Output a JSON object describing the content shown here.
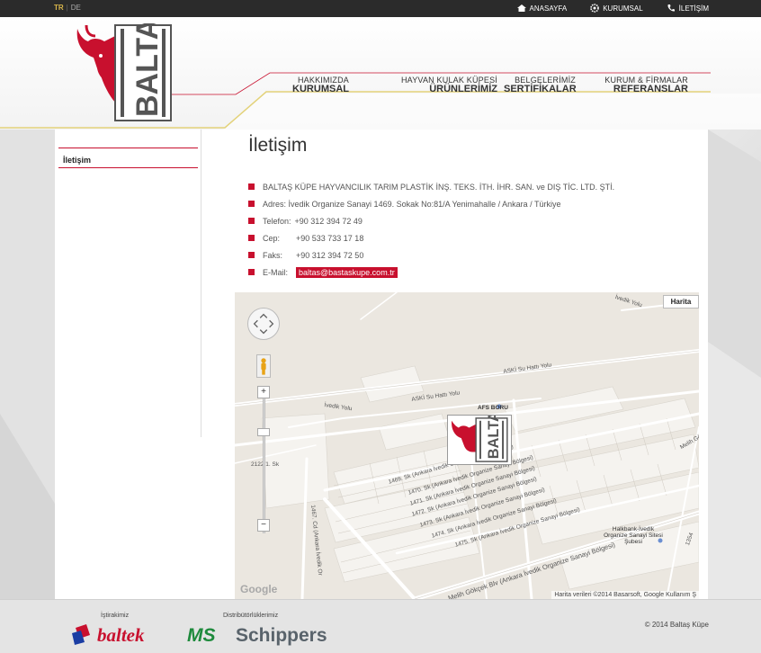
{
  "topbar": {
    "lang_tr": "TR",
    "lang_de": "DE",
    "nav": [
      {
        "label": "ANASAYFA",
        "icon": "home-icon"
      },
      {
        "label": "KURUMSAL",
        "icon": "gear-icon"
      },
      {
        "label": "İLETİŞİM",
        "icon": "phone-icon"
      }
    ]
  },
  "brand": {
    "name": "BALTAŞ",
    "accent": "#c8102e"
  },
  "mainnav": [
    {
      "small": "HAKKIMIZDA",
      "big": "KURUMSAL"
    },
    {
      "small": "HAYVAN KULAK KÜPESİ",
      "big": "ÜRÜNLERİMİZ"
    },
    {
      "small": "BELGELERİMİZ",
      "big": "SERTİFİKALAR"
    },
    {
      "small": "KURUM & FİRMALAR",
      "big": "REFERANSLAR"
    }
  ],
  "sidebar": {
    "items": [
      {
        "label": "İletişim"
      }
    ]
  },
  "page": {
    "title": "İletişim"
  },
  "contact": {
    "company": "BALTAŞ KÜPE HAYVANCILIK TARIM PLASTİK İNŞ. TEKS. İTH. İHR. SAN. ve DIŞ TİC. LTD. ŞTİ.",
    "address": "Adres: İvedik Organize Sanayi 1469. Sokak No:81/A Yenimahalle / Ankara / Türkiye",
    "phone_label": "Telefon:",
    "phone": "+90 312 394 72 49",
    "mobile_label": "Cep:",
    "mobile": "+90 533 733 17 18",
    "fax_label": "Faks:",
    "fax": "+90 312 394 72 50",
    "email_label": "E-Mail:",
    "email": "baltas@bastaskupe.com.tr"
  },
  "map": {
    "type_button": "Harita",
    "google": "Google",
    "attribution": "Harita verileri ©2014 Basarsoft, Google    Kullanım Ş",
    "labels": {
      "ivedik_yolu_top": "İvedik Yolu",
      "aski_1": "ASKİ Su Hattı Yolu",
      "aski_2": "ASKİ Su Hattı Yolu",
      "ivedik_yolu": "İvedik Yolu",
      "afs": "AFS BORU",
      "sk2122": "2122/1. Sk",
      "melih": "Melih Gö",
      "sk1469": "1469. Sk (Ankara İvedik Organize Sanayi Bölgesi)",
      "sk1470": "1470. Sk (Ankara İvedik Organize Sanayi Bölgesi)",
      "sk1471": "1471. Sk (Ankara İvedik Organize Sanayi Bölgesi)",
      "sk1472": "1472. Sk (Ankara İvedik Organize Sanayi Bölgesi)",
      "sk1473": "1473. Sk (Ankara İvedik Organize Sanayi Bölgesi)",
      "sk1474": "1474. Sk (Ankara İvedik Organize Sanayi Bölgesi)",
      "sk1475": "1475. Sk (Ankara İvedik Organize Sanayi Bölgesi)",
      "cd1467": "1467. Cd (Ankara İvedik Or",
      "gokcek": "Melih Gökçek Blv (Ankara İvedik Organize Sanayi Bölgesi)",
      "halkbank": "Halkbank-İvedik Organize Sanayi Sitesi Şubesi",
      "sk1354": "1354"
    }
  },
  "footer": {
    "partner_label": "İştirakimiz",
    "partner_name": "baltek",
    "dist_label": "Distribütörlüklerimiz",
    "dist_name": "Schippers",
    "copyright": "© 2014 Baltaş Küpe"
  }
}
